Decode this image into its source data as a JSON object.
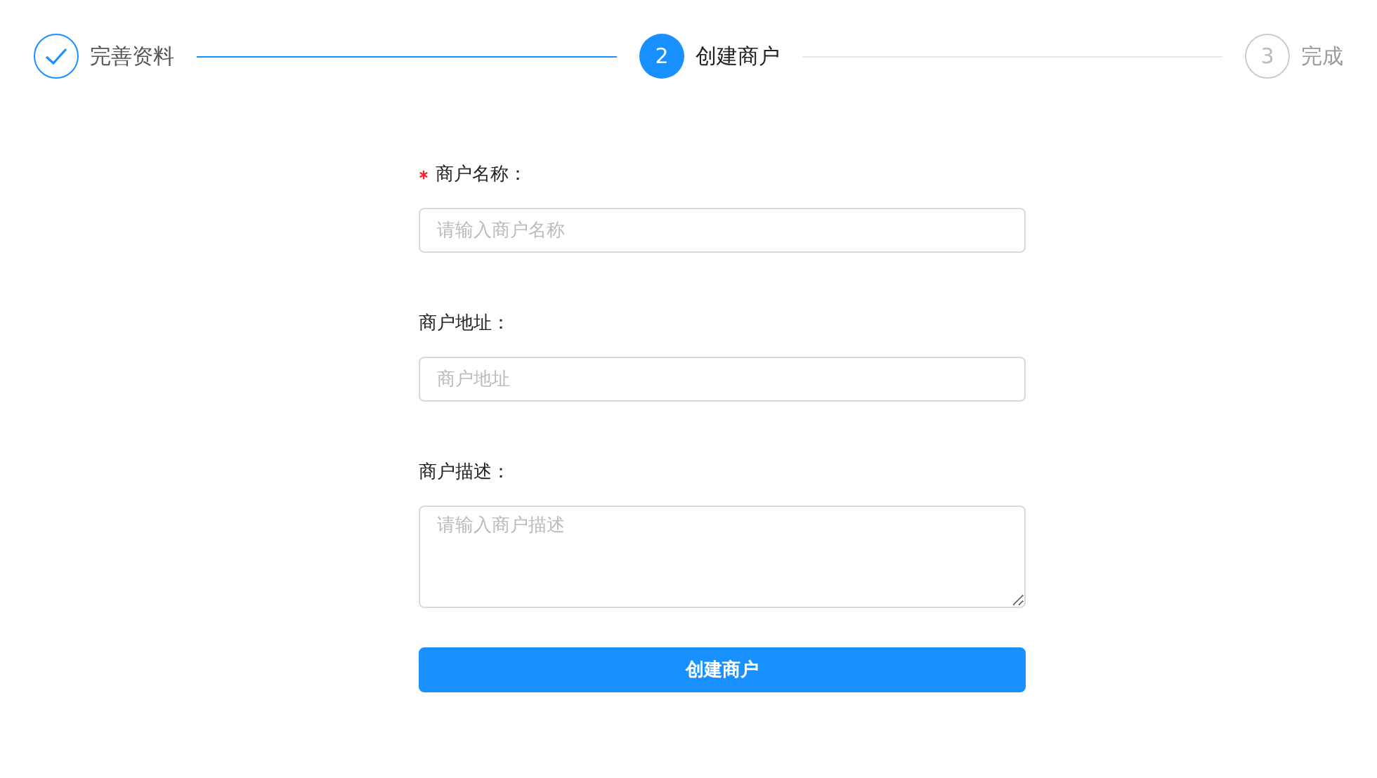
{
  "steps": [
    {
      "label": "完善资料",
      "kind": "finish"
    },
    {
      "label": "创建商户",
      "kind": "process",
      "number": "2"
    },
    {
      "label": "完成",
      "kind": "wait",
      "number": "3"
    }
  ],
  "form": {
    "fields": [
      {
        "kind": "input",
        "label": "商户名称：",
        "required": true,
        "placeholder": "请输入商户名称"
      },
      {
        "kind": "input",
        "label": "商户地址：",
        "required": false,
        "placeholder": "商户地址"
      },
      {
        "kind": "textarea",
        "label": "商户描述：",
        "required": false,
        "placeholder": "请输入商户描述"
      }
    ],
    "submit": "创建商户"
  }
}
